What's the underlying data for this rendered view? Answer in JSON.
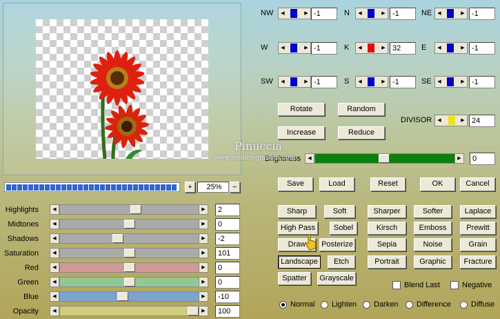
{
  "preview": {
    "zoom": "25%",
    "zoom_plus": "+",
    "zoom_minus": "−"
  },
  "sliders": [
    {
      "label": "Highlights",
      "value": "2",
      "fill": 0.55,
      "color": "#aaaaaa"
    },
    {
      "label": "Midtones",
      "value": "0",
      "fill": 0.5,
      "color": "#aaaaaa"
    },
    {
      "label": "Shadows",
      "value": "-2",
      "fill": 0.41,
      "color": "#aaaaaa"
    },
    {
      "label": "Saturation",
      "value": "101",
      "fill": 0.5,
      "color": "#aaaaaa"
    },
    {
      "label": "Red",
      "value": "0",
      "fill": 0.5,
      "color": "#d09a98"
    },
    {
      "label": "Green",
      "value": "0",
      "fill": 0.5,
      "color": "#93c793"
    },
    {
      "label": "Blue",
      "value": "-10",
      "fill": 0.45,
      "color": "#7da3cf"
    },
    {
      "label": "Opacity",
      "value": "100",
      "fill": 1.0,
      "color": "#d0cc80"
    }
  ],
  "matrix": [
    {
      "label": "NW",
      "value": "-1",
      "knob": "#0000cc"
    },
    {
      "label": "N",
      "value": "-1",
      "knob": "#0000cc"
    },
    {
      "label": "NE",
      "value": "-1",
      "knob": "#0000cc"
    },
    {
      "label": "W",
      "value": "-1",
      "knob": "#0000cc"
    },
    {
      "label": "K",
      "value": "32",
      "knob": "#dd1111"
    },
    {
      "label": "E",
      "value": "-1",
      "knob": "#0000cc"
    },
    {
      "label": "SW",
      "value": "-1",
      "knob": "#0000cc"
    },
    {
      "label": "S",
      "value": "-1",
      "knob": "#0000cc"
    },
    {
      "label": "SE",
      "value": "-1",
      "knob": "#0000cc"
    }
  ],
  "controls": {
    "rotate": "Rotate",
    "random": "Random",
    "increase": "Increase",
    "reduce": "Reduce",
    "divisor_label": "DIVISOR",
    "divisor_value": "24",
    "brightness_label": "Brightness",
    "brightness_value": "0",
    "save": "Save",
    "load": "Load",
    "reset": "Reset",
    "ok": "OK",
    "cancel": "Cancel"
  },
  "presets": [
    "Sharp",
    "Soft",
    "Sharper",
    "Softer",
    "Laplace",
    "High Pass",
    "Sobel",
    "Kirsch",
    "Emboss",
    "Prewitt",
    "Draw",
    "Posterize",
    "Sepia",
    "Noise",
    "Grain",
    "Landscape",
    "Etch",
    "Portrait",
    "Graphic",
    "Fracture",
    "Spatter",
    "Grayscale"
  ],
  "selected_preset": "Landscape",
  "options": {
    "blend_last": "Blend Last",
    "negative": "Negative"
  },
  "blend_modes": [
    "Normal",
    "Lighten",
    "Darken",
    "Difference",
    "Diffuse"
  ],
  "selected_mode": "Normal",
  "watermark": {
    "name": "Pinuccia",
    "url": "www.moidiregtanalis.com"
  }
}
